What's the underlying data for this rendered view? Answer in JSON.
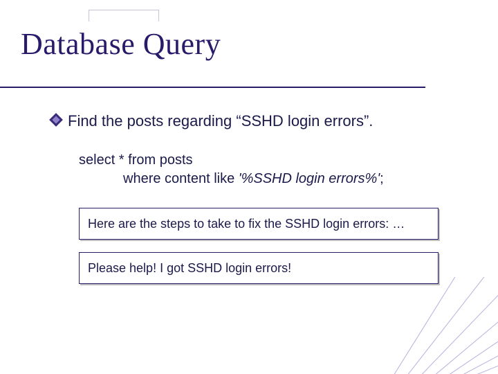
{
  "title": "Database Query",
  "bullet": "Find the posts regarding “SSHD login errors”.",
  "query": {
    "line1": "select * from posts",
    "line2_prefix": "where content like ",
    "line2_like": "'%SSHD login errors%'",
    "line2_suffix": ";"
  },
  "results": [
    "Here are the steps to take to fix the SSHD login errors: …",
    "Please help! I got SSHD login errors!"
  ]
}
